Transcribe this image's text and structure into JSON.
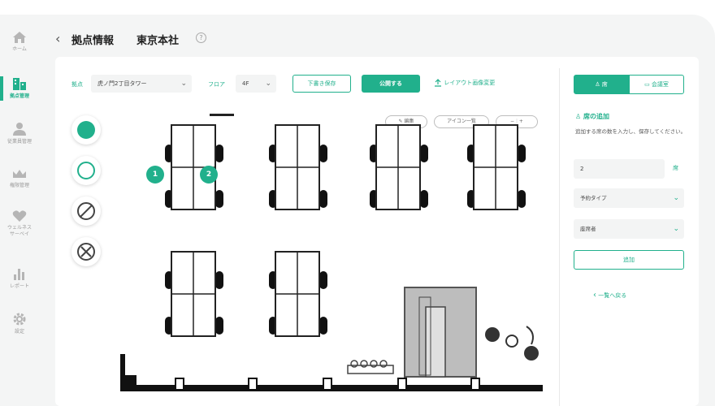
{
  "header": {
    "title": "拠点情報",
    "subtitle": "東京本社"
  },
  "nav": {
    "items": [
      {
        "label": "ホーム"
      },
      {
        "label": "拠点管理"
      },
      {
        "label": "従業員管理"
      },
      {
        "label": "権限管理"
      },
      {
        "label": "ウェルネス\nサーベイ"
      },
      {
        "label": "レポート"
      },
      {
        "label": "設定"
      }
    ]
  },
  "toolbar": {
    "location_label": "拠点",
    "location_value": "虎ノ門2丁目タワー",
    "floor_label": "フロア",
    "floor_value": "4F",
    "save_draft": "下書き保存",
    "publish": "公開する",
    "upload": "レイアウト画像変更"
  },
  "canvas": {
    "edit": "編集",
    "icon_list": "アイコン一覧",
    "zoom_minus": "−",
    "zoom_plus": "+",
    "seat_badges": [
      "1",
      "2"
    ]
  },
  "panel": {
    "tab_seat": "席",
    "tab_room": "会議室",
    "add_title": "席の追加",
    "description": "追加する席の数を入力し、保存してください。",
    "count_value": "2",
    "count_unit": "席",
    "reservation_type": "予約タイプ",
    "assignee": "座席者",
    "add_button": "追加",
    "back_link": "一覧へ戻る"
  },
  "colors": {
    "accent": "#21b08c"
  }
}
